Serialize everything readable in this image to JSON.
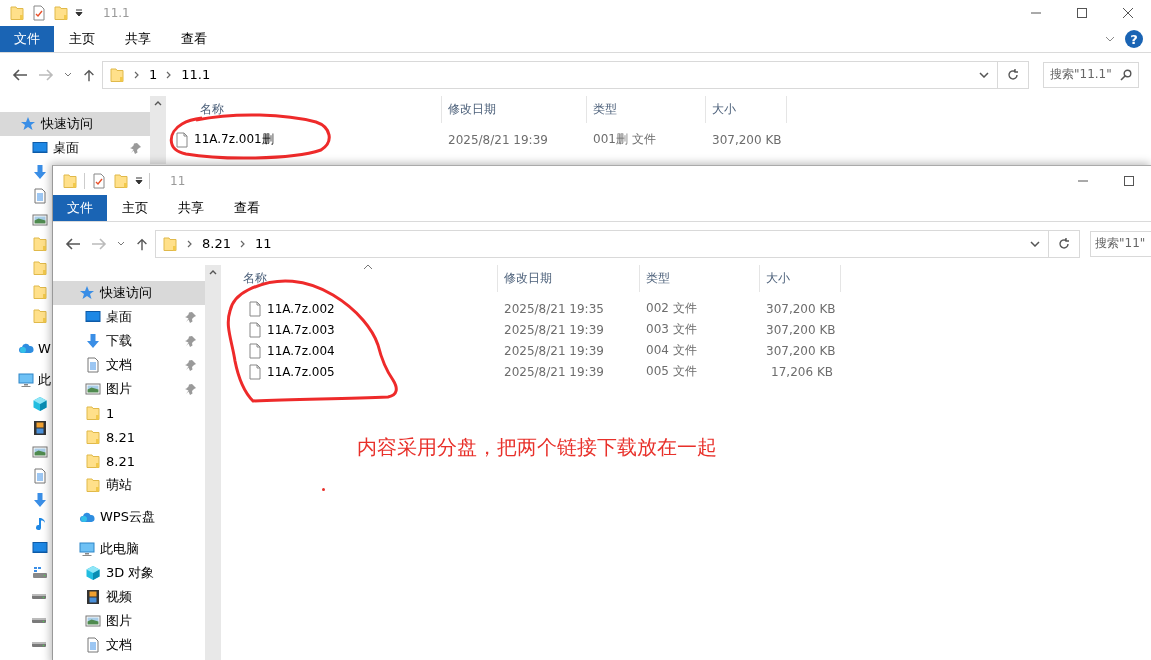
{
  "back_window": {
    "title": "11.1",
    "ribbon_tabs": [
      {
        "label": "文件",
        "selected": true
      },
      {
        "label": "主页",
        "selected": false
      },
      {
        "label": "共享",
        "selected": false
      },
      {
        "label": "查看",
        "selected": false
      }
    ],
    "help_button": "?",
    "path": [
      "1",
      "11.1"
    ],
    "search": {
      "placeholder": "搜索\"11.1\""
    },
    "sidebar": [
      {
        "kind": "quick",
        "label": "快速访问",
        "selected": true,
        "children": [
          {
            "kind": "desktop",
            "label": "桌面",
            "pinned": true,
            "selected": false
          },
          {
            "kind": "download"
          },
          {
            "kind": "doc"
          },
          {
            "kind": "pic"
          },
          {
            "kind": "folder"
          },
          {
            "kind": "folder"
          },
          {
            "kind": "folder"
          },
          {
            "kind": "folder"
          }
        ]
      },
      {
        "kind": "cloud",
        "label": "W",
        "selected": false
      },
      {
        "kind": "pc",
        "label": "此",
        "selected": false,
        "children": [
          {
            "kind": "cube"
          },
          {
            "kind": "video"
          },
          {
            "kind": "pic"
          },
          {
            "kind": "doc"
          },
          {
            "kind": "download"
          },
          {
            "kind": "music"
          },
          {
            "kind": "desktop"
          },
          {
            "kind": "netdrive"
          },
          {
            "kind": "drive"
          },
          {
            "kind": "drive"
          },
          {
            "kind": "drive"
          }
        ]
      }
    ],
    "columns": [
      "名称",
      "修改日期",
      "类型",
      "大小"
    ],
    "files": [
      {
        "name": "11A.7z.001删",
        "modified": "2025/8/21 19:39",
        "type": "001删 文件",
        "size": "307,200 KB"
      }
    ]
  },
  "front_window": {
    "title": "11",
    "ribbon_tabs": [
      {
        "label": "文件",
        "selected": true
      },
      {
        "label": "主页",
        "selected": false
      },
      {
        "label": "共享",
        "selected": false
      },
      {
        "label": "查看",
        "selected": false
      }
    ],
    "path": [
      "8.21",
      "11"
    ],
    "search": {
      "placeholder": "搜索\"11\""
    },
    "sidebar": [
      {
        "kind": "quick",
        "label": "快速访问",
        "selected": true,
        "children": [
          {
            "kind": "desktop",
            "label": "桌面",
            "pinned": true,
            "selected": false
          },
          {
            "kind": "download",
            "label": "下载",
            "pinned": true,
            "selected": false
          },
          {
            "kind": "doc",
            "label": "文档",
            "pinned": true,
            "selected": false
          },
          {
            "kind": "pic",
            "label": "图片",
            "pinned": true,
            "selected": false
          },
          {
            "kind": "folder",
            "label": "1",
            "pinned": false,
            "selected": false
          },
          {
            "kind": "folder",
            "label": "8.21",
            "pinned": false,
            "selected": false
          },
          {
            "kind": "folder",
            "label": "8.21",
            "pinned": false,
            "selected": false
          },
          {
            "kind": "folder",
            "label": "萌站",
            "pinned": false,
            "selected": false
          }
        ]
      },
      {
        "kind": "cloud",
        "label": "WPS云盘",
        "selected": false
      },
      {
        "kind": "pc",
        "label": "此电脑",
        "selected": false,
        "children": [
          {
            "kind": "cube",
            "label": "3D 对象",
            "selected": false
          },
          {
            "kind": "video",
            "label": "视频",
            "selected": false
          },
          {
            "kind": "pic",
            "label": "图片",
            "selected": false
          },
          {
            "kind": "doc",
            "label": "文档",
            "selected": false
          }
        ]
      }
    ],
    "columns": [
      "名称",
      "修改日期",
      "类型",
      "大小"
    ],
    "files": [
      {
        "name": "11A.7z.002",
        "modified": "2025/8/21 19:35",
        "type": "002 文件",
        "size": "307,200 KB"
      },
      {
        "name": "11A.7z.003",
        "modified": "2025/8/21 19:39",
        "type": "003 文件",
        "size": "307,200 KB"
      },
      {
        "name": "11A.7z.004",
        "modified": "2025/8/21 19:39",
        "type": "004 文件",
        "size": "307,200 KB"
      },
      {
        "name": "11A.7z.005",
        "modified": "2025/8/21 19:39",
        "type": "005 文件",
        "size": "17,206 KB"
      }
    ]
  },
  "annotation": {
    "text": "内容采用分盘，把两个链接下载放在一起"
  }
}
